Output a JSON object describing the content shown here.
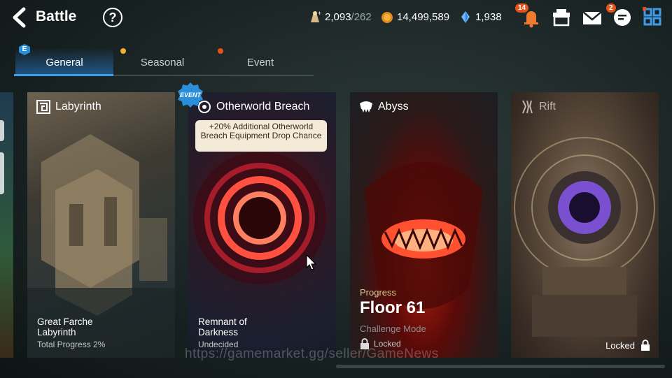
{
  "header": {
    "title": "Battle",
    "help_symbol": "?"
  },
  "resources": {
    "stamina_value": "2,093",
    "stamina_max": "/262",
    "gold": "14,499,589",
    "crystal": "1,938"
  },
  "notifications": {
    "bell_count": "14",
    "chat_count": "2"
  },
  "tabs": [
    {
      "label": "General",
      "badge": "E"
    },
    {
      "label": "Seasonal"
    },
    {
      "label": "Event"
    }
  ],
  "cards": [
    {
      "title": "Labyrinth",
      "name": "Great Farche Labyrinth",
      "status": "Total Progress 2%"
    },
    {
      "title": "Otherworld Breach",
      "event_badge": "EVENT",
      "bonus": "+20% Additional Otherworld Breach Equipment Drop Chance",
      "name": "Remnant of Darkness",
      "status": "Undecided"
    },
    {
      "title": "Abyss",
      "progress_label": "Progress",
      "floor": "Floor 61",
      "mode": "Challenge Mode",
      "lock_text": "Locked"
    },
    {
      "title": "Rift",
      "lock_text": "Locked"
    }
  ],
  "watermark": "https://gamemarket.gg/seller/GameNews",
  "colors": {
    "accent": "#3d9be8",
    "badge": "#e3541a",
    "event": "#2a8fd8"
  }
}
